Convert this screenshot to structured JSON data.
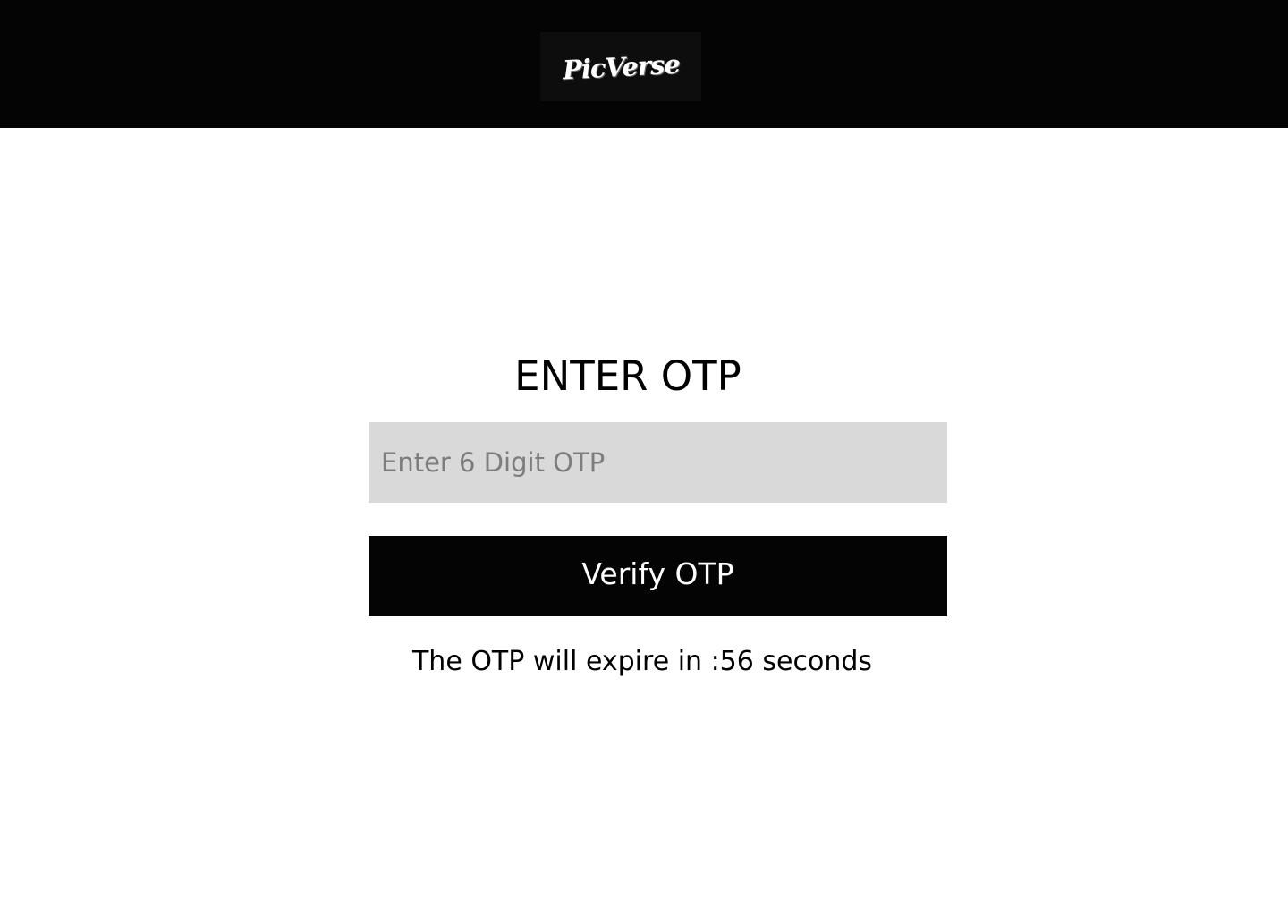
{
  "header": {
    "logo_text": "PicVerse",
    "background": "#040404"
  },
  "main": {
    "title": "ENTER OTP",
    "otp_input": {
      "value": "",
      "placeholder": "Enter 6 Digit OTP"
    },
    "verify_button_label": "Verify OTP",
    "expiry_text": "The OTP will expire in :56 seconds"
  },
  "colors": {
    "accent": "#040404",
    "input_background": "#d9d9d9",
    "placeholder": "#7d7d7d"
  }
}
